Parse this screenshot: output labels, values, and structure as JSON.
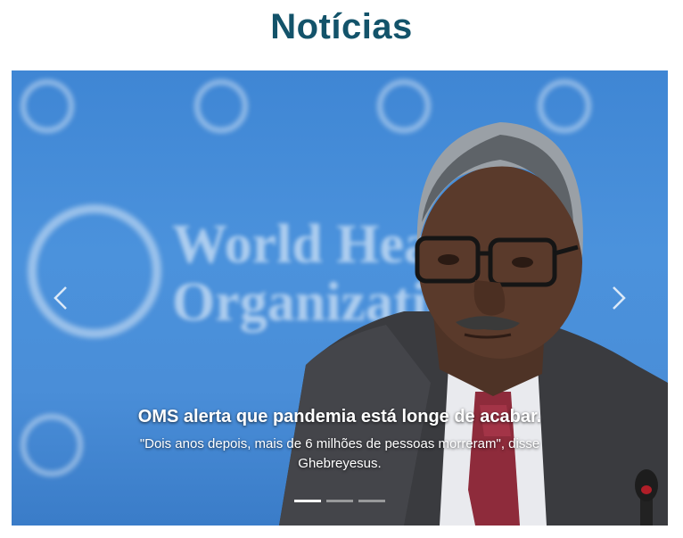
{
  "page": {
    "title": "Notícias"
  },
  "carousel": {
    "active_index": 0,
    "slide_count": 3,
    "slides": [
      {
        "image_alt": "",
        "caption_title": "OMS alerta que pandemia está longe de acabar.",
        "caption_text": "\"Dois anos depois, mais de 6 milhões de pessoas morreram\", disse Ghebreyesus."
      }
    ],
    "backdrop_text": [
      "World Health",
      "Organization"
    ],
    "controls": {
      "prev_icon": "chevron-left-icon",
      "next_icon": "chevron-right-icon"
    }
  },
  "colors": {
    "title": "#13536a",
    "backdrop_blue": "#4a8ed8",
    "indicator_active": "#ffffff"
  }
}
